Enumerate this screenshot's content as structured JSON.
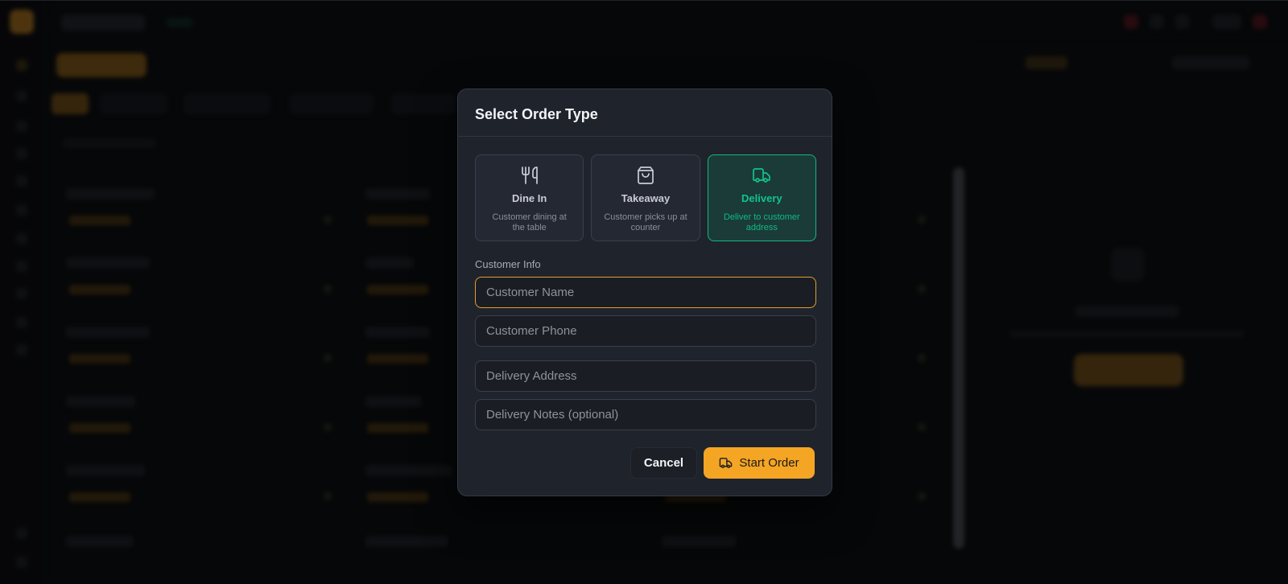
{
  "modal": {
    "title": "Select Order Type",
    "order_types": [
      {
        "label": "Dine In",
        "description": "Customer dining at the table",
        "icon": "fork-knife-icon",
        "selected": false
      },
      {
        "label": "Takeaway",
        "description": "Customer picks up at counter",
        "icon": "shopping-bag-icon",
        "selected": false
      },
      {
        "label": "Delivery",
        "description": "Deliver to customer address",
        "icon": "truck-icon",
        "selected": true
      }
    ],
    "customer_info_label": "Customer Info",
    "fields": {
      "customer_name": {
        "placeholder": "Customer Name",
        "value": ""
      },
      "customer_phone": {
        "placeholder": "Customer Phone",
        "value": ""
      },
      "delivery_address": {
        "placeholder": "Delivery Address",
        "value": ""
      },
      "delivery_notes": {
        "placeholder": "Delivery Notes (optional)",
        "value": ""
      }
    },
    "cancel_label": "Cancel",
    "start_label": "Start Order"
  },
  "colors": {
    "accent": "#f5a524",
    "selected": "#10b981",
    "modal_bg": "#1f232c",
    "page_bg": "#0c0d10"
  }
}
